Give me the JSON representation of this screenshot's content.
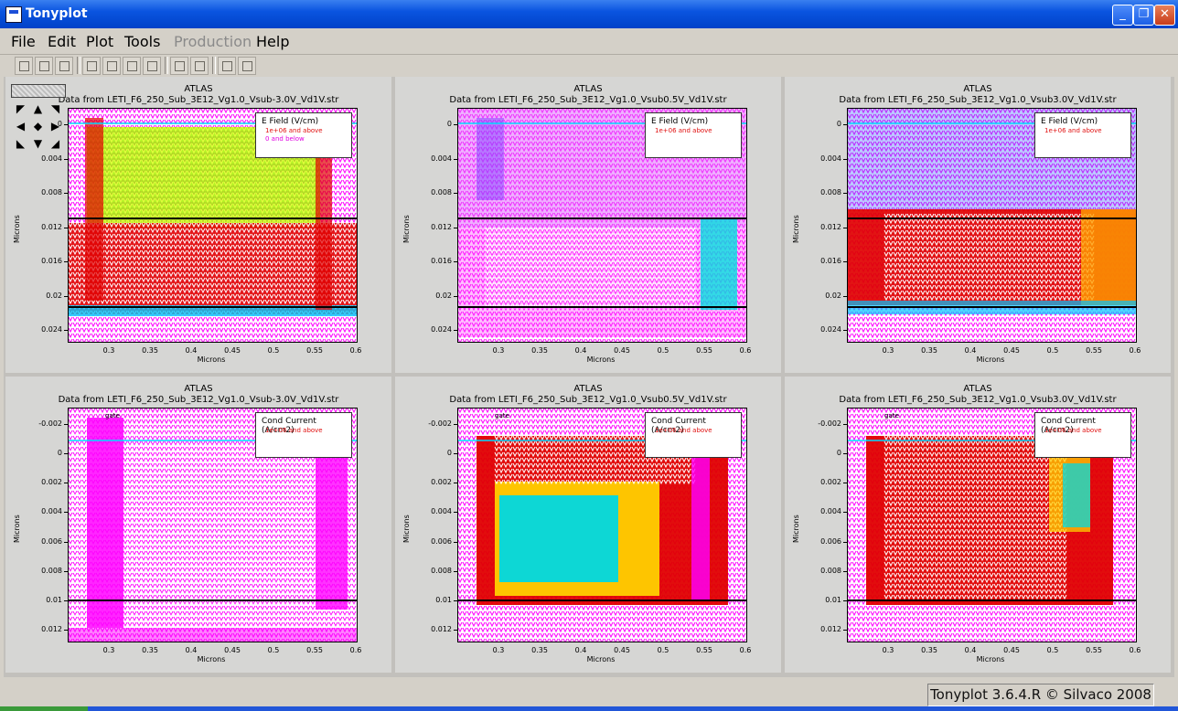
{
  "window": {
    "title": "Tonyplot",
    "minimize_label": "_",
    "restore_label": "❐",
    "close_label": "✕"
  },
  "menu": {
    "items": [
      {
        "label": "File",
        "enabled": true
      },
      {
        "label": "Edit",
        "enabled": true
      },
      {
        "label": "Plot",
        "enabled": true
      },
      {
        "label": "Tools",
        "enabled": true
      },
      {
        "label": "Production",
        "enabled": false
      },
      {
        "label": "Help",
        "enabled": true
      }
    ]
  },
  "toolbar": {
    "buttons": [
      "load-icon",
      "save-icon",
      "print-icon",
      "select-icon",
      "copy-icon",
      "paste-icon",
      "duplicate-icon",
      "zoom-in-icon",
      "zoom-out-icon",
      "prev-icon",
      "next-icon"
    ]
  },
  "navpad": {
    "arrows": [
      "◤",
      "▲",
      "◥",
      "◀",
      "◆",
      "▶",
      "◣",
      "▼",
      "◢"
    ]
  },
  "panels": [
    {
      "header": "ATLAS",
      "subtitle": "Data from LETI_F6_250_Sub_3E12_Vg1.0_Vsub-3.0V_Vd1V.str",
      "legend_title": "E Field (V/cm)",
      "legend_entries": [
        "1e+06 and above",
        "0 and below"
      ],
      "yticks": [
        "0",
        "0.004",
        "0.008",
        "0.012",
        "0.016",
        "0.02",
        "0.024"
      ],
      "xticks": [
        "0.3",
        "0.35",
        "0.4",
        "0.45",
        "0.5",
        "0.55",
        "0.6"
      ],
      "xlabel": "Microns",
      "ylabel": "Microns",
      "palette": [
        "#e00000",
        "#a8f000",
        "#ff00ff",
        "#00c8ff",
        "#3060ff"
      ],
      "style": "efield-left"
    },
    {
      "header": "ATLAS",
      "subtitle": "Data from LETI_F6_250_Sub_3E12_Vg1.0_Vsub0.5V_Vd1V.str",
      "legend_title": "E Field (V/cm)",
      "legend_entries": [
        "1e+06 and above",
        ""
      ],
      "yticks": [
        "0",
        "0.004",
        "0.008",
        "0.012",
        "0.016",
        "0.02",
        "0.024"
      ],
      "xticks": [
        "0.3",
        "0.35",
        "0.4",
        "0.45",
        "0.5",
        "0.55",
        "0.6"
      ],
      "xlabel": "Microns",
      "ylabel": "Microns",
      "palette": [
        "#ff00ff",
        "#e060ff",
        "#ff00ff",
        "#00e0e0",
        "#8040ff"
      ],
      "style": "efield-mid"
    },
    {
      "header": "ATLAS",
      "subtitle": "Data from LETI_F6_250_Sub_3E12_Vg1.0_Vsub3.0V_Vd1V.str",
      "legend_title": "E Field (V/cm)",
      "legend_entries": [
        "1e+06 and above",
        ""
      ],
      "yticks": [
        "0",
        "0.004",
        "0.008",
        "0.012",
        "0.016",
        "0.02",
        "0.024"
      ],
      "xticks": [
        "0.3",
        "0.35",
        "0.4",
        "0.45",
        "0.5",
        "0.55",
        "0.6"
      ],
      "xlabel": "Microns",
      "ylabel": "Microns",
      "palette": [
        "#ff00ff",
        "#e00000",
        "#ffa000",
        "#00c8ff",
        "#4060ff"
      ],
      "style": "efield-right"
    },
    {
      "header": "ATLAS",
      "subtitle": "Data from LETI_F6_250_Sub_3E12_Vg1.0_Vsub-3.0V_Vd1V.str",
      "legend_title": "Cond Current (A/cm2)",
      "legend_entries": [
        "1e+06 and above",
        ""
      ],
      "gate_label": "gate",
      "yticks": [
        "-0.002",
        "0",
        "0.002",
        "0.004",
        "0.006",
        "0.008",
        "0.01",
        "0.012"
      ],
      "xticks": [
        "0.3",
        "0.35",
        "0.4",
        "0.45",
        "0.5",
        "0.55",
        "0.6"
      ],
      "xlabel": "Microns",
      "ylabel": "Microns",
      "palette": [
        "#ff00ff",
        "#ff00ff",
        "#ff00ff",
        "#ff00ff",
        "#ff00ff"
      ],
      "style": "current-left"
    },
    {
      "header": "ATLAS",
      "subtitle": "Data from LETI_F6_250_Sub_3E12_Vg1.0_Vsub0.5V_Vd1V.str",
      "legend_title": "Cond Current (A/cm2)",
      "legend_entries": [
        "1e+06 and above",
        ""
      ],
      "gate_label": "gate",
      "yticks": [
        "-0.002",
        "0",
        "0.002",
        "0.004",
        "0.006",
        "0.008",
        "0.01",
        "0.012"
      ],
      "xticks": [
        "0.3",
        "0.35",
        "0.4",
        "0.45",
        "0.5",
        "0.55",
        "0.6"
      ],
      "xlabel": "Microns",
      "ylabel": "Microns",
      "palette": [
        "#e00000",
        "#ffd000",
        "#00d8e0",
        "#e8f000",
        "#ff00ff"
      ],
      "style": "current-mid"
    },
    {
      "header": "ATLAS",
      "subtitle": "Data from LETI_F6_250_Sub_3E12_Vg1.0_Vsub3.0V_Vd1V.str",
      "legend_title": "Cond Current (A/cm2)",
      "legend_entries": [
        "1e+06 and above",
        ""
      ],
      "gate_label": "gate",
      "yticks": [
        "-0.002",
        "0",
        "0.002",
        "0.004",
        "0.006",
        "0.008",
        "0.01",
        "0.012"
      ],
      "xticks": [
        "0.3",
        "0.35",
        "0.4",
        "0.45",
        "0.5",
        "0.55",
        "0.6"
      ],
      "xlabel": "Microns",
      "ylabel": "Microns",
      "palette": [
        "#e00000",
        "#ff00ff",
        "#ffd000",
        "#00d8e0",
        "#e00000"
      ],
      "style": "current-right"
    }
  ],
  "status": {
    "text": "Tonyplot 3.6.4.R © Silvaco 2008"
  }
}
